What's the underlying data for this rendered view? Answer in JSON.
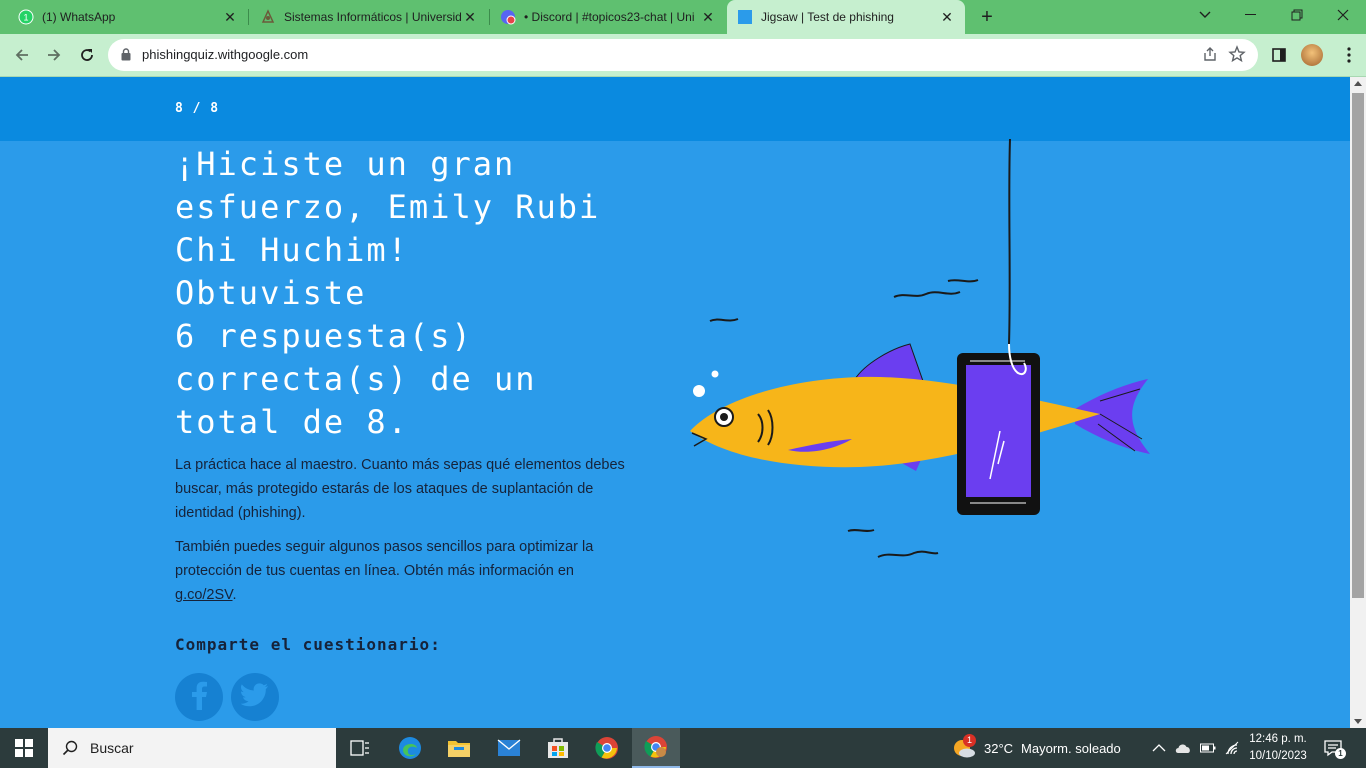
{
  "browser": {
    "tabs": [
      {
        "title": "(1) WhatsApp",
        "favicon": "whatsapp-icon"
      },
      {
        "title": "Sistemas Informáticos | Universid",
        "favicon": "university-icon"
      },
      {
        "title": "• Discord | #topicos23-chat | Uni",
        "favicon": "discord-icon"
      },
      {
        "title": "Jigsaw | Test de phishing",
        "favicon": "jigsaw-icon",
        "active": true
      }
    ],
    "url": "phishingquiz.withgoogle.com"
  },
  "page": {
    "progress": "8 / 8",
    "headline_lines": [
      "¡Hiciste un gran",
      "esfuerzo, Emily Rubi",
      "Chi Huchim!",
      "Obtuviste",
      "6 respuesta(s)",
      "correcta(s) de un",
      "total de 8."
    ],
    "paragraph1": "La práctica hace al maestro. Cuanto más sepas qué elementos debes buscar, más protegido estarás de los ataques de suplantación de identidad (phishing).",
    "paragraph2_text": "También puedes seguir algunos pasos sencillos para optimizar la protección de tus cuentas en línea. Obtén más información en ",
    "paragraph2_link": "g.co/2SV",
    "paragraph2_end": ".",
    "share_label": "Comparte el cuestionario:",
    "social": [
      "facebook-icon",
      "twitter-icon"
    ]
  },
  "taskbar": {
    "search_placeholder": "Buscar",
    "weather_temp": "32°C",
    "weather_desc": "Mayorm. soleado",
    "weather_badge": "1",
    "time": "12:46 p. m.",
    "date": "10/10/2023"
  },
  "colors": {
    "page_bg": "#2b9bea",
    "header_bg": "#0a8ae0",
    "tabstrip": "#5fc070",
    "toolbar": "#c6efcf",
    "fish_body": "#f7b519",
    "fish_fin": "#6b3ef0",
    "taskbar": "#2c3b3c"
  }
}
